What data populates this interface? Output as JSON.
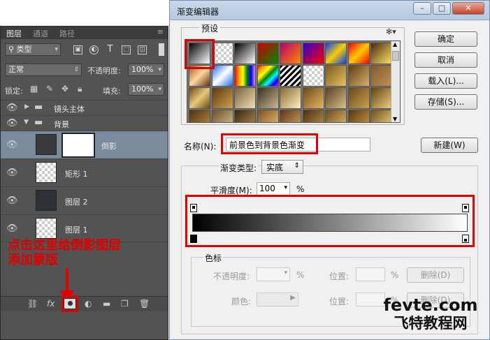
{
  "layers_panel": {
    "tabs": [
      "图层",
      "通道",
      "路径"
    ],
    "filter_kind": "类型",
    "blend_mode": "正常",
    "opacity_label": "不透明度:",
    "opacity_value": "100%",
    "lock_label": "锁定:",
    "fill_label": "填充:",
    "fill_value": "100%",
    "layers": [
      {
        "name": "镜头主体",
        "type": "group",
        "expanded": false
      },
      {
        "name": "背景",
        "type": "group",
        "expanded": true
      },
      {
        "name": "倒影",
        "type": "layer",
        "selected": true
      },
      {
        "name": "矩形 1",
        "type": "layer"
      },
      {
        "name": "图层 2",
        "type": "layer"
      },
      {
        "name": "图层 1",
        "type": "layer"
      }
    ],
    "annotation": [
      "点击这里给倒影图层",
      "添加蒙版"
    ],
    "bottom_icons": [
      "link-icon",
      "fx-icon",
      "mask-icon",
      "adjustment-icon",
      "folder-icon",
      "new-layer-icon",
      "trash-icon"
    ],
    "fx_label": "fx"
  },
  "dialog": {
    "title": "渐变编辑器",
    "presets_label": "预设",
    "name_label": "名称(N):",
    "name_value": "前景色到背景色渐变",
    "new_button": "新建(W)",
    "buttons": [
      "确定",
      "取消",
      "载入(L)...",
      "存储(S)..."
    ],
    "gradient_type_label": "渐变类型:",
    "gradient_type_value": "实底",
    "smoothness_label": "平滑度(M):",
    "smoothness_value": "100",
    "smoothness_unit": "%",
    "stops_group_label": "色标",
    "opacity_label": "不透明度:",
    "color_label": "颜色:",
    "location_label": "位置:",
    "percent": "%",
    "delete_label": "删除(D)"
  },
  "watermark": {
    "line1": "fevte.com",
    "line2": "飞特教程网"
  }
}
